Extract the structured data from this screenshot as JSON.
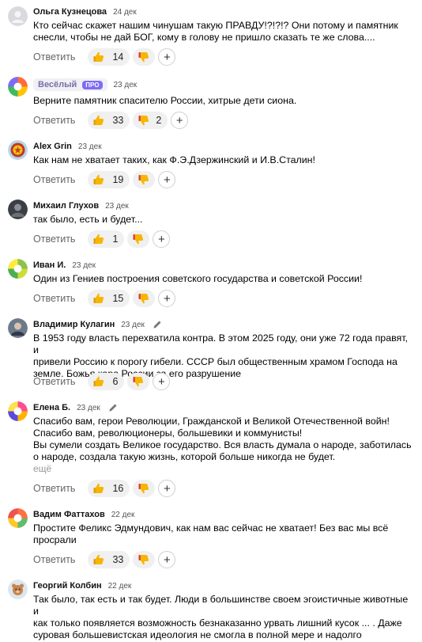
{
  "ui": {
    "reply_label": "Ответить",
    "add_reaction": "+",
    "more_label": "ещё"
  },
  "comments": [
    {
      "author": "Ольга Кузнецова",
      "date": "24 дек",
      "text": "Кто сейчас скажет нашим чинушам такую ПРАВДУ!?!?!? Они потому и памятник\nснесли, чтобы не дай БОГ, кому в голову не пришло сказать те же слова....",
      "likes": "14",
      "dislikes": ""
    },
    {
      "author": "Весёлый",
      "badge": "ПРО",
      "date": "23 дек",
      "text": "Верните памятник спасителю России, хитрые дети сиона.",
      "likes": "33",
      "dislikes": "2"
    },
    {
      "author": "Alex Grin",
      "date": "23 дек",
      "text": "Как нам не хватает таких, как Ф.Э.Дзержинский и И.В.Сталин!",
      "likes": "19",
      "dislikes": ""
    },
    {
      "author": "Михаил Глухов",
      "date": "23 дек",
      "text": "так было, есть и будет...",
      "likes": "1",
      "dislikes": ""
    },
    {
      "author": "Иван И.",
      "date": "23 дек",
      "text": "Один из Гениев построения советского государства и советской России!",
      "likes": "15",
      "dislikes": ""
    },
    {
      "author": "Владимир Кулагин",
      "date": "23 дек",
      "edited": true,
      "text": "В 1953 году власть перехватила контра. В этом 2025 году, они уже 72 года правят, и\nпривели Россию к порогу гибели. СССР был общественным храмом Господа на\nземле. Божья кара России за его разрушение",
      "likes": "6",
      "dislikes": ""
    },
    {
      "author": "Елена Б.",
      "date": "23 дек",
      "edited": true,
      "text": "Спасибо вам, герои Революции, Гражданской и Великой Отечественной войн!\nСпасибо вам, революционеры, большевики и коммунисты!\nВы сумели создать Великое государство. Вся власть думала о народе, заботилась\nо народе, создала такую жизнь, которой больше никогда не будет.",
      "likes": "16",
      "dislikes": ""
    },
    {
      "author": "Вадим Фаттахов",
      "date": "22 дек",
      "text": "Простите Феликс Эдмундович, как нам вас сейчас не хватает! Без вас мы всё\nпросрали",
      "likes": "33",
      "dislikes": ""
    },
    {
      "author": "Георгий Колбин",
      "date": "22 дек",
      "text": "Так было, так есть и так будет. Люди в большинстве своем эгоистичные животные и\nкак только появляется возможность безнаказанно урвать лишний кусок ... . Даже\nсуровая большевистская идеология не смогла в полной мере и надолго установить\nсоциальную справедливость."
    }
  ],
  "colors": {
    "like_bg": "#f0f0f0",
    "pro_badge": "#7d6cf5",
    "muted_text": "#666666"
  }
}
